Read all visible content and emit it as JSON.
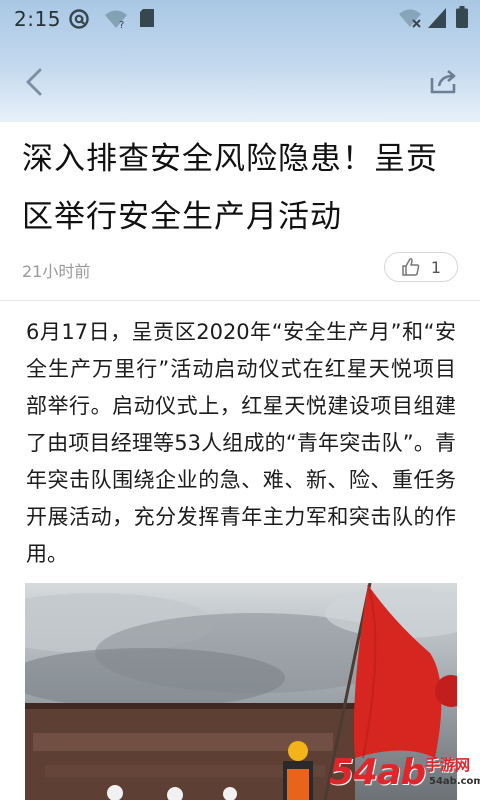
{
  "status_bar": {
    "time": "2:15",
    "left_icons": [
      "at-sign-icon",
      "wifi-question-icon",
      "sd-card-icon"
    ],
    "right_icons": [
      "wifi-icon",
      "cell-signal-icon",
      "battery-icon"
    ]
  },
  "nav": {
    "back_icon": "back-arrow-icon",
    "share_icon": "share-icon"
  },
  "article": {
    "title": "深入排查安全风险隐患！呈贡区举行安全生产月活动",
    "time": "21小时前",
    "like_count": "1",
    "body": "6月17日，呈贡区2020年“安全生产月”和“安全生产万里行”活动启动仪式在红星天悦项目部举行。启动仪式上，红星天悦建设项目组建了由项目经理等53人组成的“青年突击队”。青年突击队围绕企业的急、难、新、险、重任务开展活动，充分发挥青年主力军和突击队的作用。"
  },
  "watermark": {
    "number": "54ab",
    "site": "手游网",
    "domain": "54ab.com.cn"
  },
  "colors": {
    "header_top": "#a9c7e4",
    "header_bottom": "#e8f1fa",
    "flag_red": "#d7261f",
    "watermark_red": "#e0262b"
  }
}
